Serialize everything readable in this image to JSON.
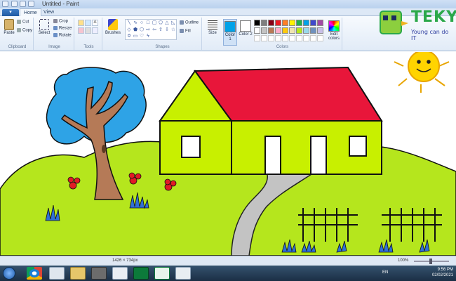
{
  "window": {
    "title": "Untitled - Paint"
  },
  "tabs": [
    {
      "label": "Home"
    },
    {
      "label": "View"
    }
  ],
  "clipboard": {
    "paste": "Paste",
    "cut": "Cut",
    "copy": "Copy",
    "group": "Clipboard"
  },
  "image": {
    "select": "Select",
    "crop": "Crop",
    "resize": "Resize",
    "rotate": "Rotate",
    "group": "Image"
  },
  "tools": {
    "group": "Tools"
  },
  "brushes": {
    "label": "Brushes"
  },
  "shapes": {
    "outline": "Outline",
    "fill": "Fill",
    "group": "Shapes"
  },
  "size": {
    "label": "Size"
  },
  "colors": {
    "color1": "Color 1",
    "color2": "Color 2",
    "edit": "Edit colors",
    "group": "Colors",
    "palette": [
      "#000000",
      "#7f7f7f",
      "#880015",
      "#ed1c24",
      "#ff7f27",
      "#fff200",
      "#22b14c",
      "#00a2e8",
      "#3f48cc",
      "#a349a4",
      "#ffffff",
      "#c3c3c3",
      "#b97a57",
      "#ffaec9",
      "#ffc90e",
      "#efe4b0",
      "#b5e61d",
      "#99d9ea",
      "#7092be",
      "#c8bfe7"
    ]
  },
  "logo": {
    "name": "TEKY",
    "tagline": "Young can do IT"
  },
  "status": {
    "dimensions": "1426 × 734px",
    "zoom": "100%"
  },
  "taskbar": {
    "lang": "EN",
    "time": "9:56 PM",
    "date": "02/02/2021"
  },
  "scene_colors": {
    "sky_tree": "#2ea3e6",
    "trunk": "#b57a57",
    "grass": "#b5e61d",
    "wall": "#c8f000",
    "roof": "#e8163a",
    "path": "#c3c3c3",
    "sun": "#ffd400",
    "flower": "#e11b25",
    "shrub": "#2f6fd6"
  }
}
